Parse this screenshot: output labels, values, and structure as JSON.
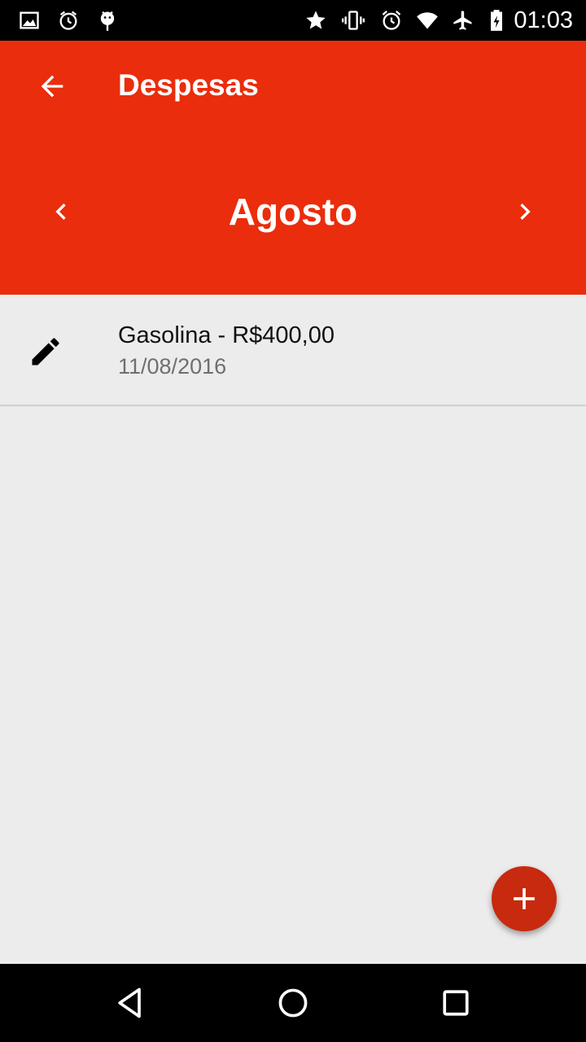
{
  "status_bar": {
    "time": "01:03",
    "left_icons": [
      "image-icon",
      "alarm-icon",
      "android-icon"
    ],
    "right_icons": [
      "star-icon",
      "vibrate-icon",
      "alarm-icon",
      "wifi-icon",
      "airplane-icon",
      "battery-charging-icon"
    ]
  },
  "header": {
    "title": "Despesas",
    "month": "Agosto"
  },
  "expenses": [
    {
      "title": "Gasolina - R$400,00",
      "date": "11/08/2016"
    }
  ],
  "colors": {
    "primary": "#ea2d0c",
    "fab": "#c72a0e",
    "background": "#ececec"
  }
}
